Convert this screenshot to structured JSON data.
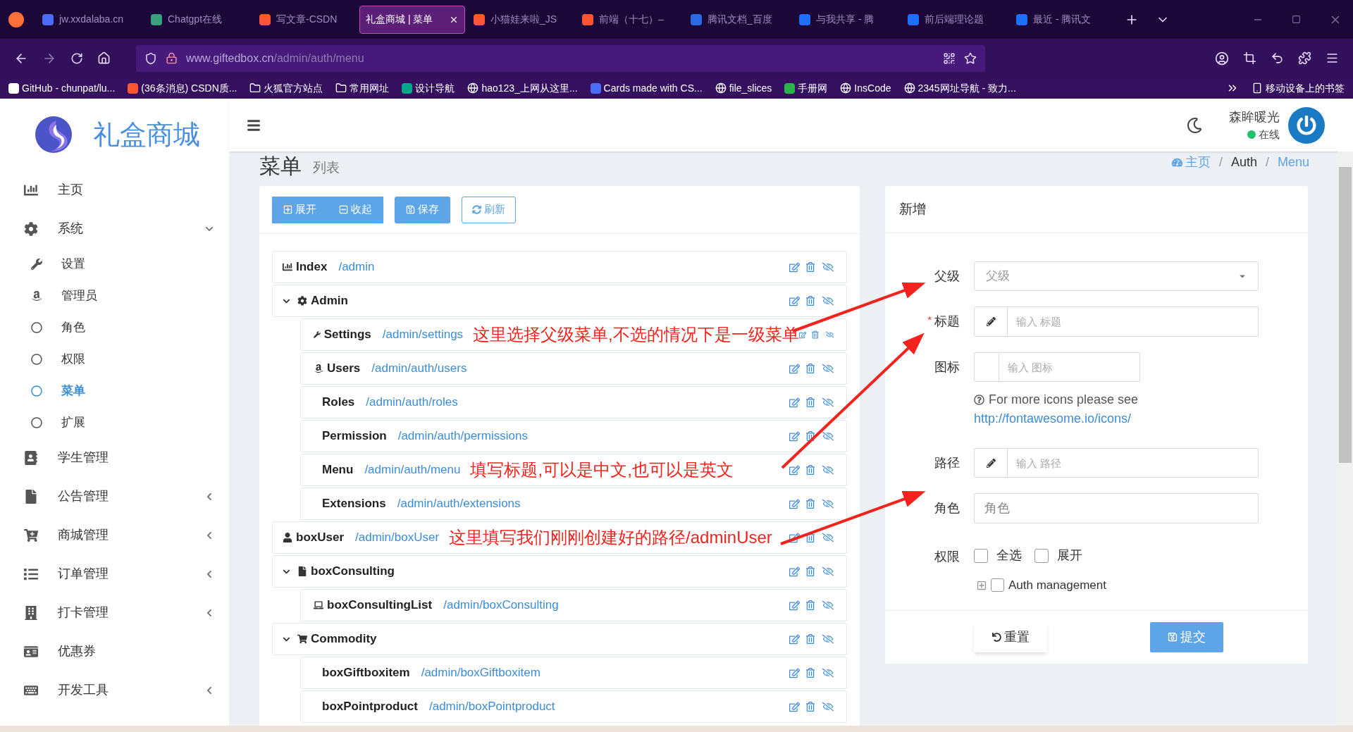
{
  "browser": {
    "tabs": [
      {
        "title": "jw.xxdalaba.cn",
        "selected": false
      },
      {
        "title": "Chatgpt在线",
        "selected": false
      },
      {
        "title": "写文章-CSDN",
        "selected": false
      },
      {
        "title": "礼盒商城 | 菜单",
        "selected": true
      },
      {
        "title": "小猫娃来啦_JS",
        "selected": false
      },
      {
        "title": "前端（十七）–",
        "selected": false
      },
      {
        "title": "腾讯文档_百度",
        "selected": false
      },
      {
        "title": "与我共享 - 腾",
        "selected": false
      },
      {
        "title": "前后端理论题",
        "selected": false
      },
      {
        "title": "最近 - 腾讯文",
        "selected": false
      }
    ],
    "url_host": "www.giftedbox.cn",
    "url_path": "/admin/auth/menu",
    "bookmarks": [
      "GitHub - chunpat/lu...",
      "(36条消息) CSDN质...",
      "火狐官方站点",
      "常用网址",
      "设计导航",
      "hao123_上网从这里...",
      "Cards made with CS...",
      "file_slices",
      "手册网",
      "InsCode",
      "2345网址导航 - 致力..."
    ],
    "mobile_bookmarks": "移动设备上的书签"
  },
  "sidebar": {
    "brand": "礼盒商城",
    "items": [
      {
        "label": "主页"
      },
      {
        "label": "系统",
        "expanded": true,
        "children": [
          {
            "label": "设置",
            "selected": false
          },
          {
            "label": "管理员",
            "selected": false
          },
          {
            "label": "角色",
            "selected": false
          },
          {
            "label": "权限",
            "selected": false
          },
          {
            "label": "菜单",
            "selected": true
          },
          {
            "label": "扩展",
            "selected": false
          }
        ]
      },
      {
        "label": "学生管理"
      },
      {
        "label": "公告管理",
        "expanded": false
      },
      {
        "label": "商城管理",
        "expanded": false
      },
      {
        "label": "订单管理",
        "expanded": false
      },
      {
        "label": "打卡管理",
        "expanded": false
      },
      {
        "label": "优惠券"
      },
      {
        "label": "开发工具",
        "expanded": false
      }
    ]
  },
  "header": {
    "user_name": "森眸暖光",
    "status": "在线"
  },
  "page": {
    "title": "菜单",
    "subtitle": "列表",
    "breadcrumb": [
      "主页",
      "/",
      "Auth",
      "/",
      "Menu"
    ]
  },
  "toolbar": [
    "展开",
    "收起",
    "保存",
    "刷新"
  ],
  "tree": [
    {
      "title": "Index",
      "path": "/admin"
    },
    {
      "title": "Admin",
      "expanded": true,
      "children": [
        {
          "title": "Settings",
          "path": "/admin/settings"
        },
        {
          "title": "Users",
          "path": "/admin/auth/users"
        },
        {
          "title": "Roles",
          "path": "/admin/auth/roles"
        },
        {
          "title": "Permission",
          "path": "/admin/auth/permissions"
        },
        {
          "title": "Menu",
          "path": "/admin/auth/menu"
        },
        {
          "title": "Extensions",
          "path": "/admin/auth/extensions"
        }
      ]
    },
    {
      "title": "boxUser",
      "path": "/admin/boxUser"
    },
    {
      "title": "boxConsulting",
      "expanded": true,
      "children": [
        {
          "title": "boxConsultingList",
          "path": "/admin/boxConsulting"
        }
      ]
    },
    {
      "title": "Commodity",
      "expanded": true,
      "children": [
        {
          "title": "boxGiftboxitem",
          "path": "/admin/boxGiftboxitem"
        },
        {
          "title": "boxPointproduct",
          "path": "/admin/boxPointproduct"
        }
      ]
    }
  ],
  "form": {
    "title": "新增",
    "parent": {
      "label": "父级",
      "placeholder": "父级"
    },
    "title_field": {
      "label": "标题",
      "required_mark": "*",
      "placeholder": "输入 标题"
    },
    "icon_field": {
      "label": "图标",
      "placeholder": "输入 图标",
      "help": "For more icons please see",
      "link": "http://fontawesome.io/icons/"
    },
    "path_field": {
      "label": "路径",
      "placeholder": "输入 路径"
    },
    "roles": {
      "label": "角色",
      "placeholder": "角色"
    },
    "permissions": {
      "label": "权限",
      "options": [
        {
          "label": "全选",
          "checked": false
        },
        {
          "label": "展开",
          "checked": false
        }
      ],
      "tree": [
        {
          "label": "Auth management",
          "checked": false
        }
      ]
    },
    "reset": "重置",
    "submit": "提交"
  },
  "annotations": [
    {
      "text": "这里选择父级菜单,不选的情况下是一级菜单"
    },
    {
      "text": "填写标题,可以是中文,也可以是英文"
    },
    {
      "text": "这里填写我们刚刚创建好的路径/adminUser"
    }
  ]
}
